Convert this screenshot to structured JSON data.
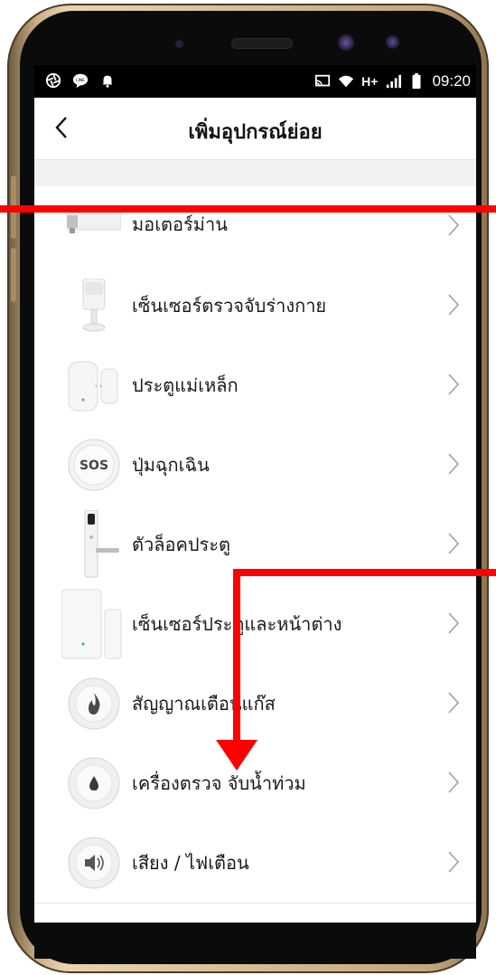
{
  "status_bar": {
    "time": "09:20",
    "network": "H+",
    "left_icons": [
      "aperture-icon",
      "line-app-icon",
      "notification-bell-icon"
    ],
    "right_icons": [
      "cast-icon",
      "wifi-icon",
      "signal-icon",
      "battery-icon"
    ]
  },
  "nav": {
    "title": "เพิ่มอุปกรณ์ย่อย",
    "back_icon": "chevron-left-icon"
  },
  "devices": [
    {
      "label": "มอเตอร์ม่าน",
      "icon": "curtain-motor-icon"
    },
    {
      "label": "เซ็นเซอร์ตรวจจับร่างกาย",
      "icon": "motion-sensor-icon"
    },
    {
      "label": "ประตูแม่เหล็ก",
      "icon": "door-magnet-icon"
    },
    {
      "label": "ปุ่มฉุกเฉิน",
      "icon": "sos-button-icon",
      "icon_text": "SOS"
    },
    {
      "label": "ตัวล็อคประตู",
      "icon": "door-lock-icon"
    },
    {
      "label": "เซ็นเซอร์ประตูและหน้าต่าง",
      "icon": "door-window-sensor-icon"
    },
    {
      "label": "สัญญาณเตือนแก๊ส",
      "icon": "gas-alarm-icon"
    },
    {
      "label": "เครื่องตรวจ จับน้ำท่วม",
      "icon": "water-leak-icon"
    },
    {
      "label": "เสียง / ไฟเตือน",
      "icon": "siren-icon"
    }
  ],
  "colors": {
    "annotation_red": "#ff0000",
    "phone_gold": "#c9ad82",
    "section_gray": "#f2f2f4"
  }
}
